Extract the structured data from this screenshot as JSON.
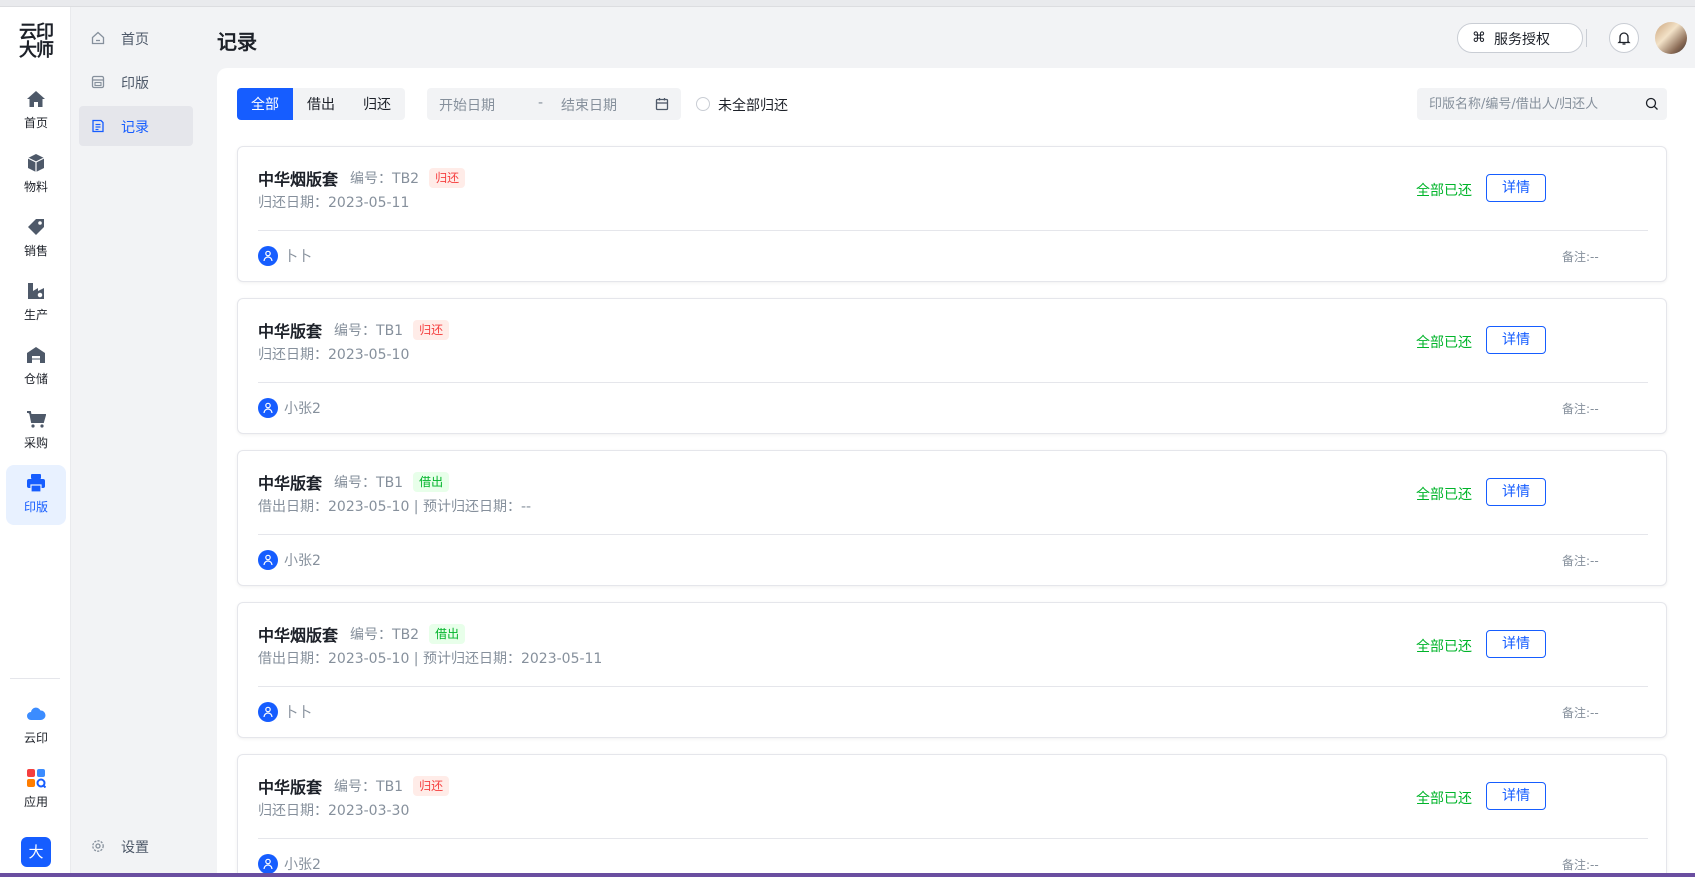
{
  "app": {
    "logo_line1": "云印",
    "logo_line2": "大师"
  },
  "rail": {
    "items": [
      {
        "label": "首页",
        "icon": "home-icon"
      },
      {
        "label": "物料",
        "icon": "box-icon"
      },
      {
        "label": "销售",
        "icon": "tag-icon"
      },
      {
        "label": "生产",
        "icon": "factory-icon"
      },
      {
        "label": "仓储",
        "icon": "warehouse-icon"
      },
      {
        "label": "采购",
        "icon": "cart-icon"
      },
      {
        "label": "印版",
        "icon": "printer-icon"
      }
    ],
    "bottom": [
      {
        "label": "云印",
        "icon": "cloud-icon"
      },
      {
        "label": "应用",
        "icon": "apps-icon"
      }
    ],
    "avatar_text": "大"
  },
  "subnav": {
    "items": [
      {
        "label": "首页",
        "icon": "home-outline-icon"
      },
      {
        "label": "印版",
        "icon": "plate-icon"
      },
      {
        "label": "记录",
        "icon": "record-icon"
      }
    ],
    "settings_label": "设置"
  },
  "header": {
    "title": "记录",
    "service_icon": "⌘",
    "service_label": "服务授权"
  },
  "filters": {
    "segments": [
      "全部",
      "借出",
      "归还"
    ],
    "active_segment": "全部",
    "start_placeholder": "开始日期",
    "separator": "-",
    "end_placeholder": "结束日期",
    "radio_label": "未全部归还",
    "search_placeholder": "印版名称/编号/借出人/归还人"
  },
  "colors": {
    "primary": "#165dff",
    "success": "#00b42a",
    "danger": "#f53f3f"
  },
  "records": [
    {
      "name": "中华烟版套",
      "code": "编号：TB2",
      "tag": "归还",
      "tag_type": "ret",
      "date": "归还日期：2023-05-11",
      "status": "全部已还",
      "detail": "详情",
      "user": "卜卜",
      "note": "备注:--"
    },
    {
      "name": "中华版套",
      "code": "编号：TB1",
      "tag": "归还",
      "tag_type": "ret",
      "date": "归还日期：2023-05-10",
      "status": "全部已还",
      "detail": "详情",
      "user": "小张2",
      "note": "备注:--"
    },
    {
      "name": "中华版套",
      "code": "编号：TB1",
      "tag": "借出",
      "tag_type": "out",
      "date": "借出日期：2023-05-10 | 预计归还日期：--",
      "status": "全部已还",
      "detail": "详情",
      "user": "小张2",
      "note": "备注:--"
    },
    {
      "name": "中华烟版套",
      "code": "编号：TB2",
      "tag": "借出",
      "tag_type": "out",
      "date": "借出日期：2023-05-10 | 预计归还日期：2023-05-11",
      "status": "全部已还",
      "detail": "详情",
      "user": "卜卜",
      "note": "备注:--"
    },
    {
      "name": "中华版套",
      "code": "编号：TB1",
      "tag": "归还",
      "tag_type": "ret",
      "date": "归还日期：2023-03-30",
      "status": "全部已还",
      "detail": "详情",
      "user": "小张2",
      "note": "备注:--"
    }
  ]
}
